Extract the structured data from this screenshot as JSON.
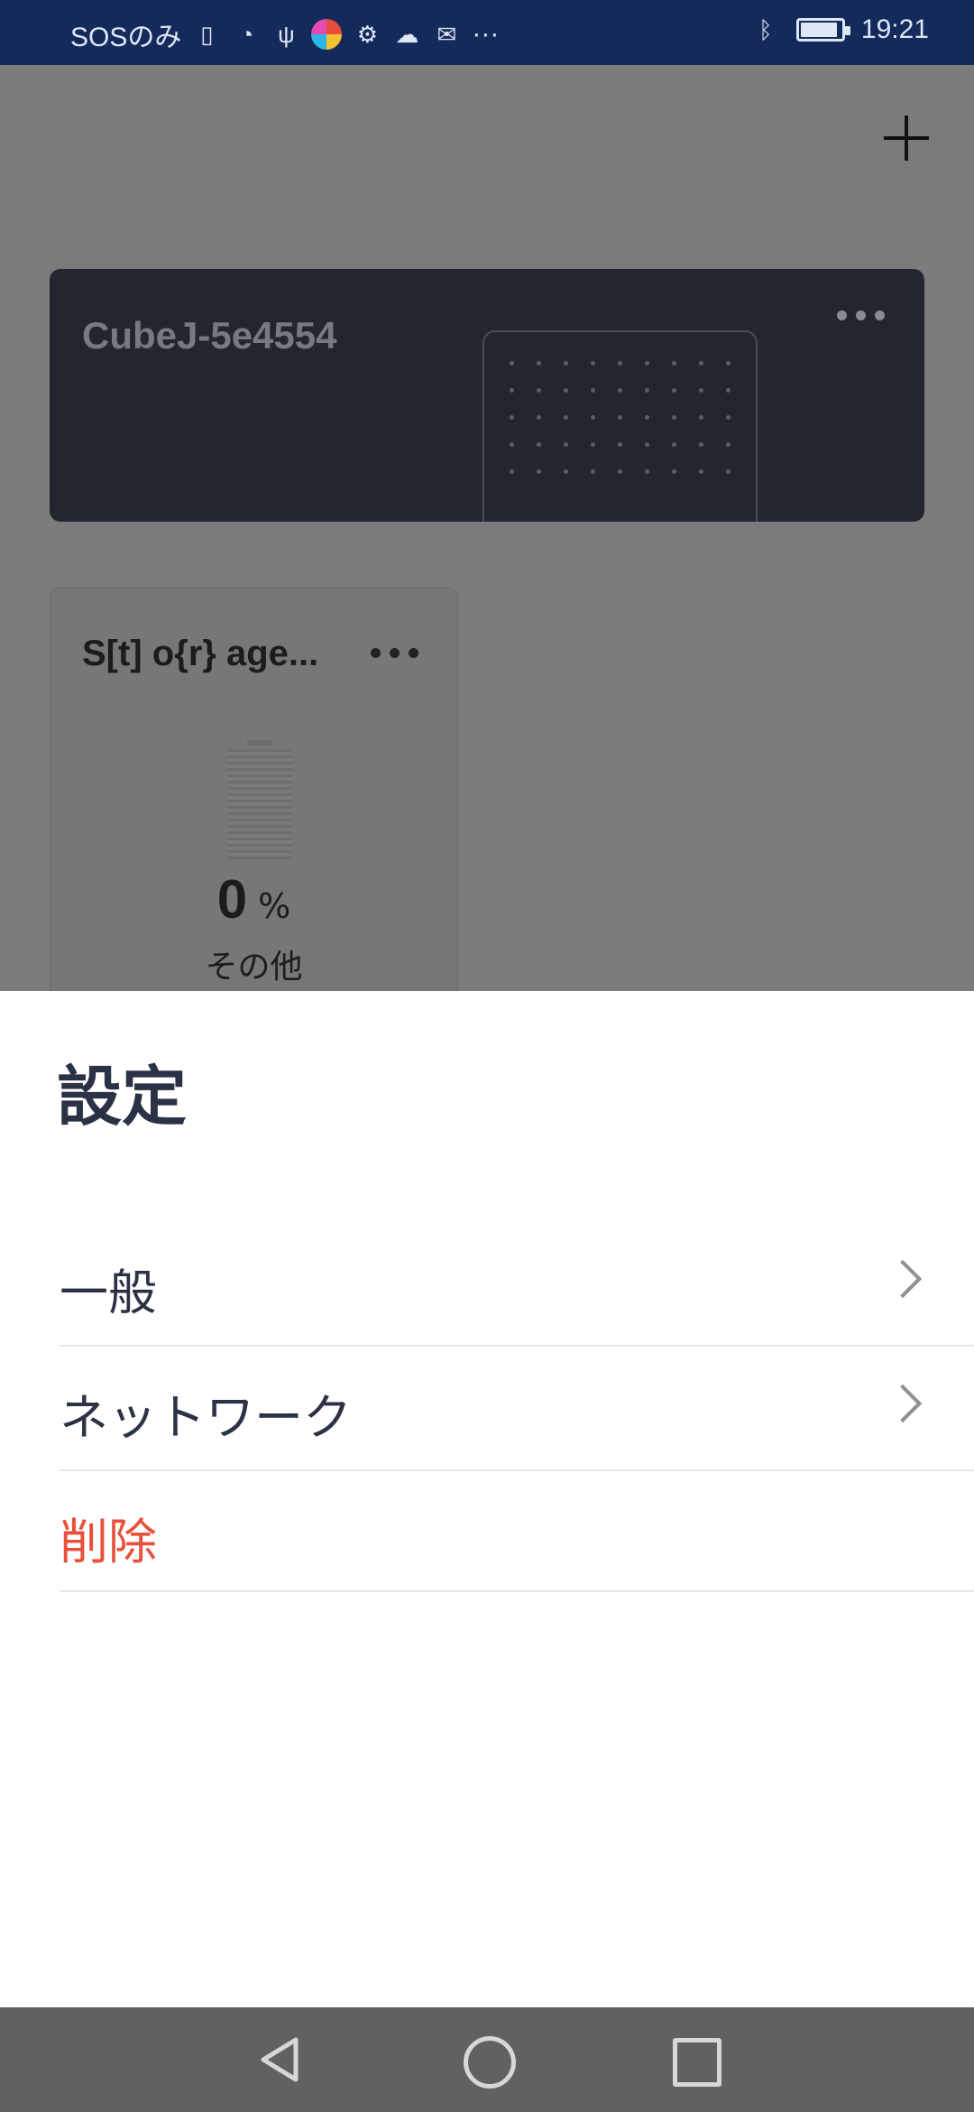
{
  "status_bar": {
    "carrier": "SOSのみ",
    "time": "19:21",
    "more": "···"
  },
  "toolbar": {
    "add_icon": "plus-icon"
  },
  "devices": [
    {
      "name": "CubeJ-5e4554",
      "menu_icon": "more-horizontal-icon"
    }
  ],
  "storage": {
    "name": "S[t] o{r} age...",
    "percent": "0",
    "unit": "%",
    "type_label": "その他"
  },
  "settings_sheet": {
    "title": "設定",
    "items": [
      {
        "label": "一般",
        "icon": "chevron-right-icon"
      },
      {
        "label": "ネットワーク",
        "icon": "chevron-right-icon"
      },
      {
        "label": "削除",
        "color": "#e9503c"
      }
    ]
  },
  "nav_bar": {
    "back_icon": "back-triangle-icon",
    "home_icon": "home-circle-icon",
    "recent_icon": "recent-square-icon"
  },
  "colors": {
    "status_bar_bg": "#142a5b",
    "cube_card_bg": "#232631",
    "danger": "#e9503c",
    "text_primary": "#2b3245"
  }
}
